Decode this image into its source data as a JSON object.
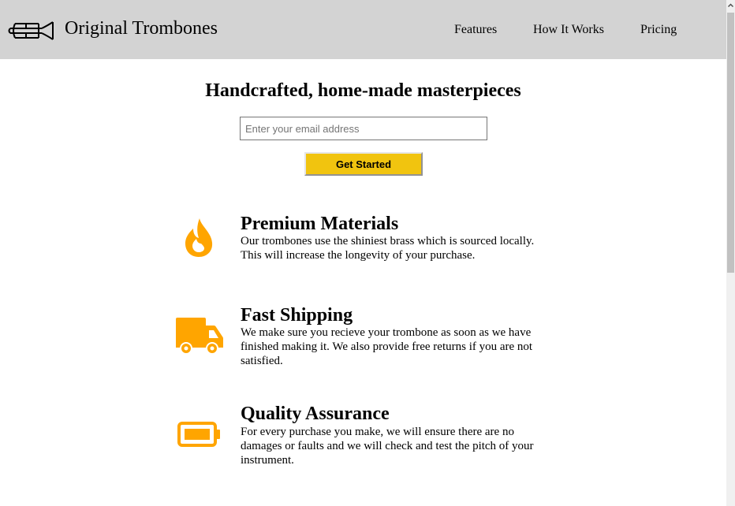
{
  "header": {
    "brand": "Original Trombones",
    "logo_icon": "trombone-icon",
    "nav": [
      "Features",
      "How It Works",
      "Pricing"
    ]
  },
  "hero": {
    "title": "Handcrafted, home-made masterpieces",
    "email_placeholder": "Enter your email address",
    "cta_label": "Get Started",
    "cta_color": "#f1c40f"
  },
  "features": [
    {
      "icon": "fire-icon",
      "title": "Premium Materials",
      "text": "Our trombones use the shiniest brass which is sourced locally. This will increase the longevity of your purchase."
    },
    {
      "icon": "truck-icon",
      "title": "Fast Shipping",
      "text": "We make sure you recieve your trombone as soon as we have finished making it. We also provide free returns if you are not satisfied."
    },
    {
      "icon": "battery-icon",
      "title": "Quality Assurance",
      "text": "For every purchase you make, we will ensure there are no damages or faults and we will check and test the pitch of your instrument."
    }
  ],
  "colors": {
    "header_bg": "#d3d3d3",
    "icon_color": "#ffa500"
  }
}
